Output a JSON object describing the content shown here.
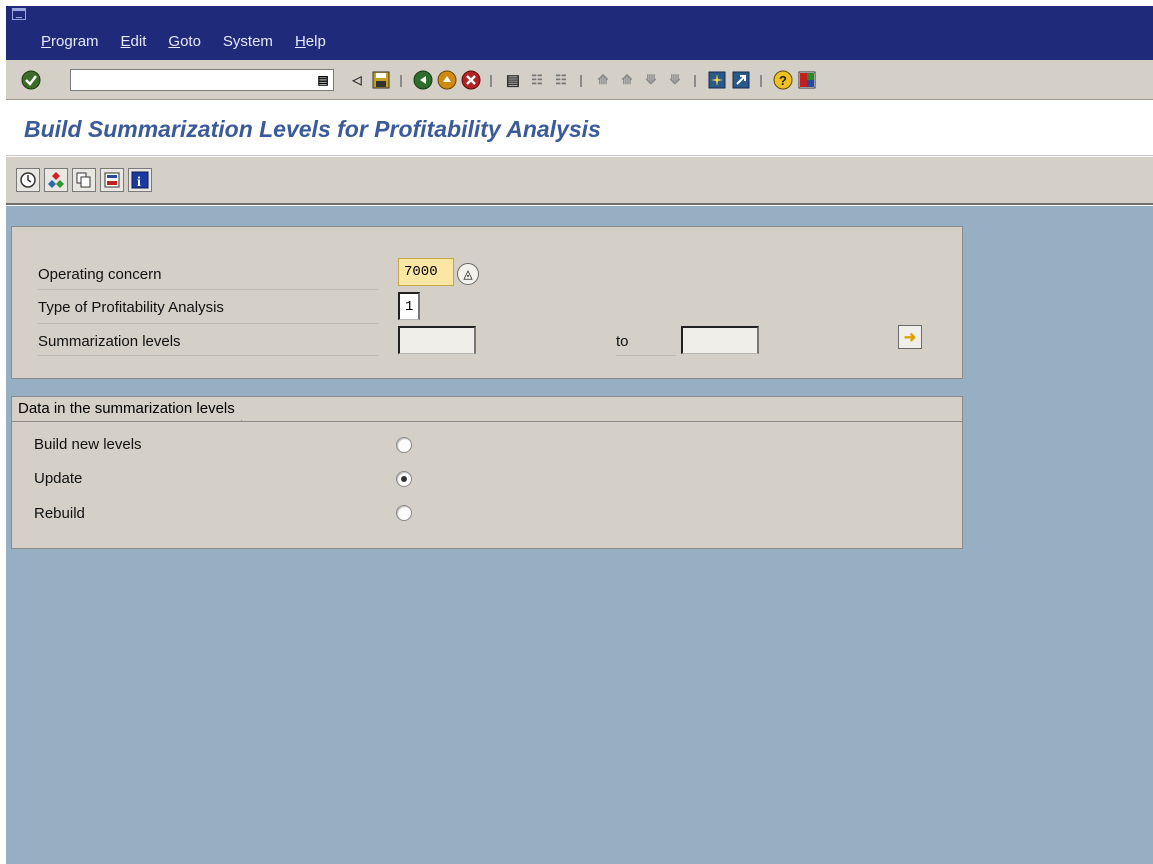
{
  "menu": {
    "items": [
      {
        "label": "Program",
        "accel": "P",
        "rest": "rogram"
      },
      {
        "label": "Edit",
        "accel": "E",
        "rest": "dit"
      },
      {
        "label": "Goto",
        "accel": "G",
        "rest": "oto"
      },
      {
        "label": "System",
        "accel": "",
        "rest": "System"
      },
      {
        "label": "Help",
        "accel": "H",
        "rest": "elp"
      }
    ]
  },
  "toolbar": {
    "command_value": ""
  },
  "page": {
    "title": "Build Summarization Levels for Profitability Analysis"
  },
  "selection": {
    "operating_concern_label": "Operating concern",
    "operating_concern_value": "7000",
    "type_label": "Type of Profitability Analysis",
    "type_value": "1",
    "levels_label": "Summarization levels",
    "levels_from": "",
    "to_label": "to",
    "levels_to": ""
  },
  "groupbox": {
    "title": "Data in the summarization levels",
    "options": [
      {
        "label": "Build new levels",
        "selected": false
      },
      {
        "label": "Update",
        "selected": true
      },
      {
        "label": "Rebuild",
        "selected": false
      }
    ]
  },
  "colors": {
    "menubar": "#1f2a7a",
    "title": "#3b5a9a",
    "background": "#96afc3",
    "panel": "#d4d0c8",
    "required_field": "#fbe6a3"
  }
}
